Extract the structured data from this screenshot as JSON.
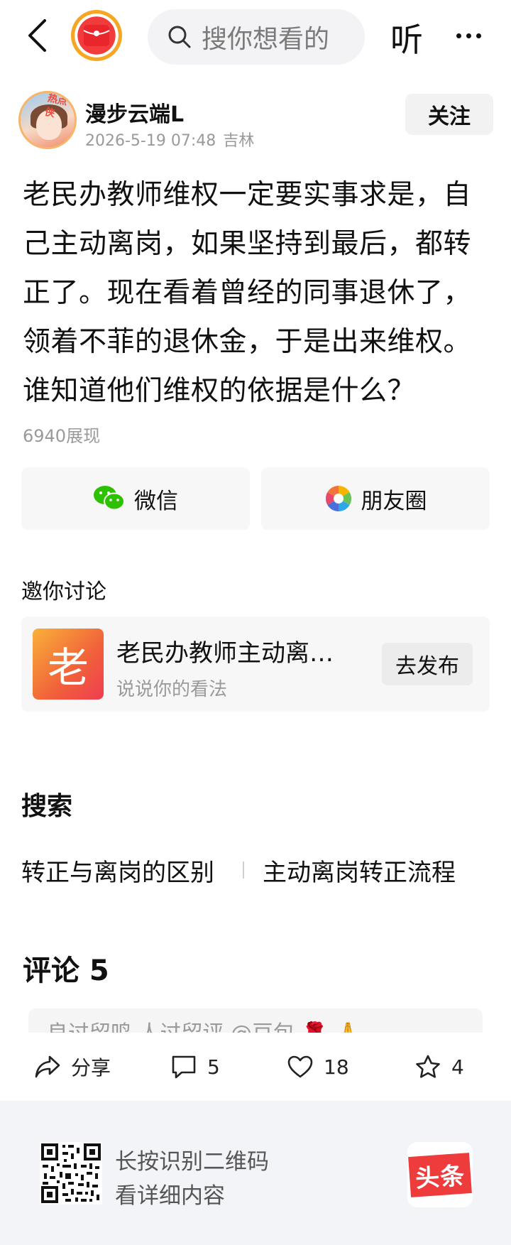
{
  "topbar": {
    "search_placeholder": "搜你想看的",
    "listen_label": "听"
  },
  "author": {
    "name": "漫步云端L",
    "avatar_badge": "热点侠",
    "datetime": "2026-5-19 07:48",
    "location": "吉林",
    "follow_label": "关注"
  },
  "post": {
    "text": "老民办教师维权一定要实事求是，自己主动离岗，如果坚持到最后，都转正了。现在看着曾经的同事退休了，领着不菲的退休金，于是出来维权。谁知道他们维权的依据是什么？",
    "views": "6940展现"
  },
  "share": {
    "wechat_label": "微信",
    "moments_label": "朋友圈"
  },
  "discuss": {
    "section_label": "邀你讨论",
    "thumb_char": "老",
    "title": "老民办教师主动离岗转正",
    "subtitle": "说说你的看法",
    "publish_label": "去发布"
  },
  "search": {
    "title": "搜索",
    "tags": [
      "转正与离岗的区别",
      "主动离岗转正流程"
    ]
  },
  "comments": {
    "title": "评论 5",
    "preview_text": "良过留鸣  人过留评    @豆包  🌹  🙏"
  },
  "actions": {
    "share_label": "分享",
    "comment_count": "5",
    "like_count": "18",
    "favorite_count": "4"
  },
  "footer": {
    "line1": "长按识别二维码",
    "line2": "看详细内容",
    "logo_text": "头条"
  },
  "colors": {
    "accent_red": "#ee3b3b",
    "wechat_green": "#2dc100",
    "muted_text": "#9a9a9a",
    "card_bg": "#f7f7f7"
  }
}
